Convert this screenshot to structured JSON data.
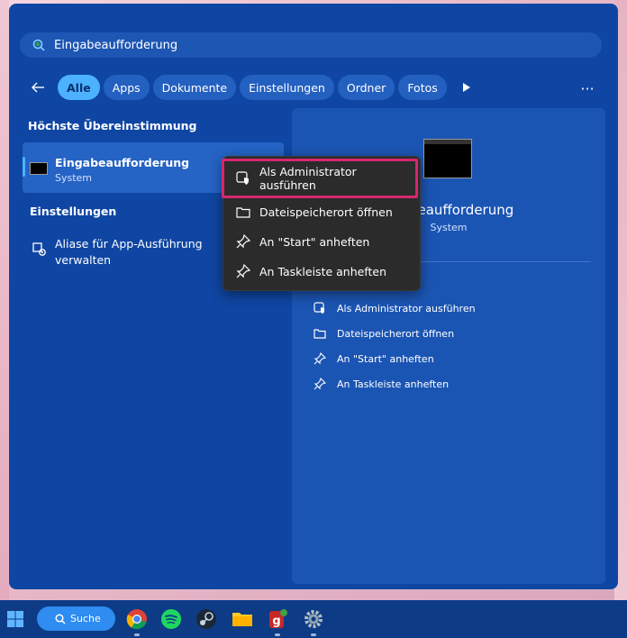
{
  "search": {
    "query": "Eingabeaufforderung"
  },
  "filters": {
    "chips": [
      {
        "label": "Alle",
        "active": true
      },
      {
        "label": "Apps",
        "active": false
      },
      {
        "label": "Dokumente",
        "active": false
      },
      {
        "label": "Einstellungen",
        "active": false
      },
      {
        "label": "Ordner",
        "active": false
      },
      {
        "label": "Fotos",
        "active": false
      }
    ],
    "more_label": "···"
  },
  "results": {
    "best_match_heading": "Höchste Übereinstimmung",
    "best_match": {
      "title": "Eingabeaufforderung",
      "subtitle": "System",
      "icon": "command-prompt-icon"
    },
    "settings_heading": "Einstellungen",
    "settings_item": {
      "label": "Aliase für App-Ausführung verwalten",
      "icon": "app-settings-icon"
    }
  },
  "context_menu": {
    "items": [
      {
        "label": "Als Administrator ausführen",
        "icon": "shield-app-icon",
        "highlighted": true
      },
      {
        "label": "Dateispeicherort öffnen",
        "icon": "folder-icon",
        "highlighted": false
      },
      {
        "label": "An \"Start\" anheften",
        "icon": "pin-icon",
        "highlighted": false
      },
      {
        "label": "An Taskleiste anheften",
        "icon": "pin-icon",
        "highlighted": false
      }
    ]
  },
  "detail": {
    "name_visible": "ngabeaufforderung",
    "type": "System",
    "actions": [
      {
        "label": "Als Administrator ausführen",
        "icon": "shield-app-icon"
      },
      {
        "label": "Dateispeicherort öffnen",
        "icon": "folder-icon"
      },
      {
        "label": "An \"Start\" anheften",
        "icon": "pin-icon"
      },
      {
        "label": "An Taskleiste anheften",
        "icon": "pin-icon"
      }
    ]
  },
  "taskbar": {
    "search_label": "Suche",
    "apps": [
      "chrome-icon",
      "spotify-icon",
      "steam-icon",
      "file-explorer-icon",
      "greenshot-icon",
      "settings-icon"
    ]
  },
  "colors": {
    "panel": "#0f46a3",
    "accent": "#4cb2ff",
    "highlight": "#d6276e",
    "menu": "#2b2b2b"
  }
}
